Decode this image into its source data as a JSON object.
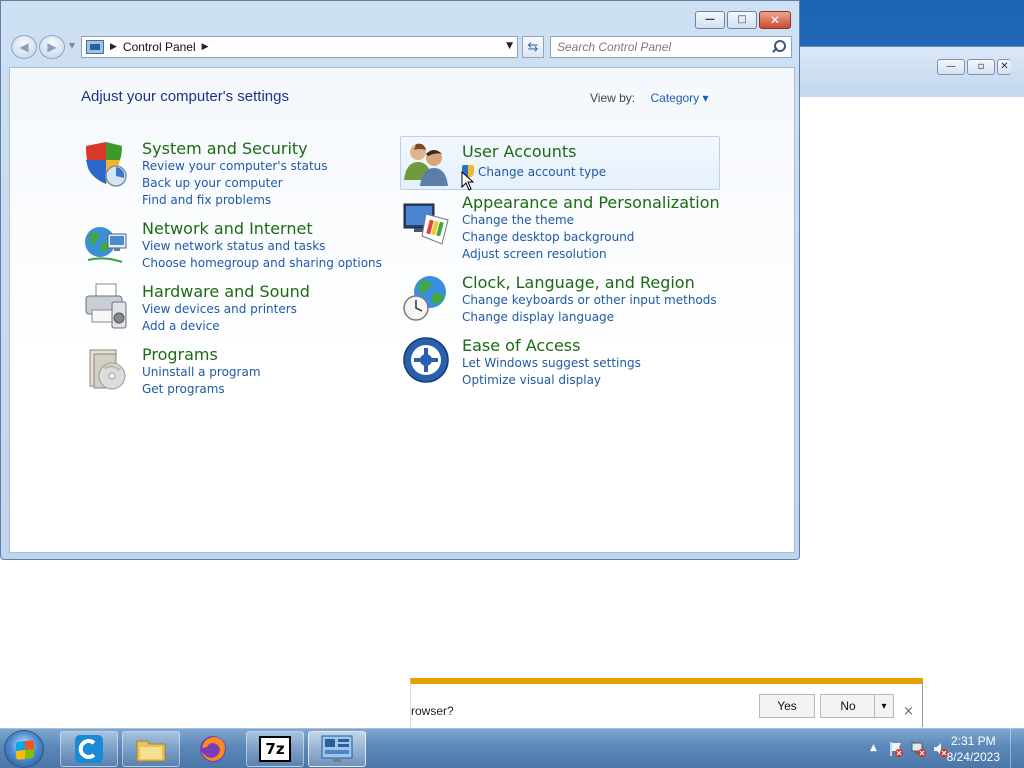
{
  "window": {
    "caption": {
      "minimize": "—",
      "maximize": "□",
      "close": "✕"
    }
  },
  "navbar": {
    "back_icon": "back-arrow-icon",
    "forward_icon": "forward-arrow-icon",
    "breadcrumb": "Control Panel",
    "search_placeholder": "Search Control Panel"
  },
  "content": {
    "heading": "Adjust your computer's settings",
    "view_by_label": "View by:",
    "view_by_value": "Category"
  },
  "categories": {
    "system": {
      "title": "System and Security",
      "links": [
        "Review your computer's status",
        "Back up your computer",
        "Find and fix problems"
      ]
    },
    "network": {
      "title": "Network and Internet",
      "links": [
        "View network status and tasks",
        "Choose homegroup and sharing options"
      ]
    },
    "hardware": {
      "title": "Hardware and Sound",
      "links": [
        "View devices and printers",
        "Add a device"
      ]
    },
    "programs": {
      "title": "Programs",
      "links": [
        "Uninstall a program",
        "Get programs"
      ]
    },
    "users": {
      "title": "User Accounts",
      "links": [
        "Change account type"
      ]
    },
    "appearance": {
      "title": "Appearance and Personalization",
      "links": [
        "Change the theme",
        "Change desktop background",
        "Adjust screen resolution"
      ]
    },
    "clock": {
      "title": "Clock, Language, and Region",
      "links": [
        "Change keyboards or other input methods",
        "Change display language"
      ]
    },
    "ease": {
      "title": "Ease of Access",
      "links": [
        "Let Windows suggest settings",
        "Optimize visual display"
      ]
    }
  },
  "notification": {
    "text": "rowser?",
    "yes": "Yes",
    "no": "No",
    "dropdown": "▾",
    "close": "×"
  },
  "taskbar": {
    "items": [
      "start-button",
      "ccleaner",
      "file-explorer",
      "firefox",
      "7zip",
      "control-panel"
    ],
    "tray_arrow": "▲",
    "time": "2:31 PM",
    "date": "8/24/2023"
  },
  "colors": {
    "category_title": "#1d6a14",
    "link": "#1f5aa6",
    "heading": "#1e3287",
    "notification_accent": "#e5a100"
  }
}
